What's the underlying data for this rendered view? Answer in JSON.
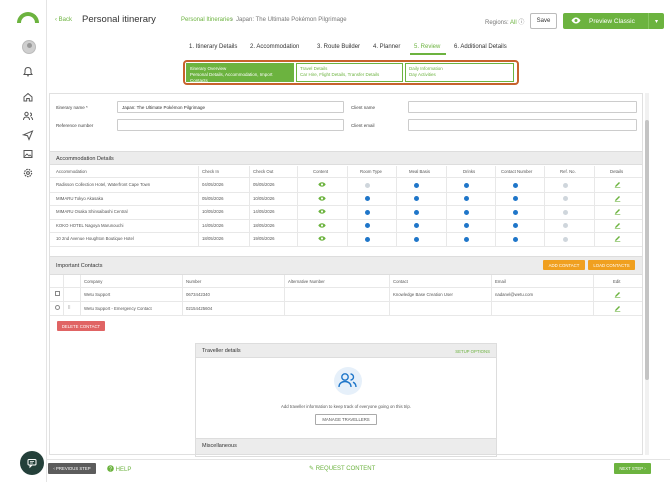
{
  "nav": {
    "icons": [
      "logo",
      "avatar",
      "bell-icon",
      "home-icon",
      "users-icon",
      "send-icon",
      "image-icon",
      "gear-icon"
    ]
  },
  "header": {
    "back": "Back",
    "title": "Personal itinerary",
    "crumb_parent": "Personal Itineraries",
    "crumb_sep": "›",
    "crumb_current": "Japan: The Ultimate Pokémon Pilgrimage",
    "regions_label": "Regions:",
    "regions_value": "All",
    "save": "Save",
    "preview": "Preview Classic",
    "preview_caret": "▾"
  },
  "steps": [
    "1. Itinerary Details",
    "2. Accommodation",
    "3. Route Builder",
    "4. Planner",
    "5. Review",
    "6. Additional Details"
  ],
  "active_step": "5. Review",
  "subtabs": [
    {
      "line1": "Itinerary Overview",
      "line2": "Personal Details, Accommodation, Import Contacts"
    },
    {
      "line1": "Travel Details",
      "line2": "Car Hire, Flight Details, Transfer Details"
    },
    {
      "line1": "Daily Information",
      "line2": "Day Activities"
    }
  ],
  "form": {
    "itinerary_name_label": "Itinerary name *",
    "itinerary_name_value": "Japan: The Ultimate Pokémon Pilgrimage",
    "reference_label": "Reference number",
    "client_name_label": "Client name",
    "client_email_label": "Client email"
  },
  "accommodation": {
    "title": "Accommodation Details",
    "columns": [
      "Accommodation",
      "Check In",
      "Check Out",
      "Content",
      "Room Type",
      "Meal Basis",
      "Drinks",
      "Contact Number",
      "Ref. No.",
      "Details"
    ],
    "rows": [
      {
        "name": "Radisson Collection Hotel, Waterfront Cape Town",
        "in": "04/05/2026",
        "out": "05/05/2026",
        "dots": [
          "grey",
          "blue",
          "blue",
          "blue",
          "grey"
        ]
      },
      {
        "name": "MIMARU Tokyo Akasaka",
        "in": "05/05/2026",
        "out": "10/05/2026",
        "dots": [
          "blue",
          "blue",
          "blue",
          "blue",
          "grey"
        ]
      },
      {
        "name": "MIMARU Osaka Shinsaibashi Central",
        "in": "10/05/2026",
        "out": "14/05/2026",
        "dots": [
          "blue",
          "blue",
          "blue",
          "blue",
          "grey"
        ]
      },
      {
        "name": "KOKO HOTEL Nagoya Marunouchi",
        "in": "14/05/2026",
        "out": "18/05/2026",
        "dots": [
          "blue",
          "blue",
          "blue",
          "blue",
          "grey"
        ]
      },
      {
        "name": "10 2nd Avenue Houghton Boutique Hotel",
        "in": "18/05/2026",
        "out": "19/05/2026",
        "dots": [
          "blue",
          "blue",
          "blue",
          "blue",
          "grey"
        ]
      }
    ]
  },
  "contacts": {
    "title": "Important Contacts",
    "add": "ADD CONTACT",
    "load": "LOAD CONTACTS",
    "columns": [
      "Company",
      "Number",
      "Alternative Number",
      "Contact",
      "Email",
      "Edit"
    ],
    "rows": [
      {
        "company": "Wetu Support",
        "number": "0673442340",
        "alt": "",
        "contact": "Knowledge Base Creation User",
        "email": "nadanel@wetu.com"
      },
      {
        "company": "Wetu Support - Emergency Contact",
        "number": "02154425604",
        "alt": "",
        "contact": "",
        "email": ""
      }
    ],
    "delete": "DELETE CONTACT"
  },
  "traveller": {
    "title": "Traveller details",
    "setup": "SETUP OPTIONS",
    "text": "Add traveller information to keep track of everyone going on this trip.",
    "manage": "MANAGE TRAVELLERS"
  },
  "misc": {
    "title": "Miscellaneous"
  },
  "footer": {
    "prev": "‹ PREVIOUS STEP",
    "help": "HELP",
    "request": "REQUEST CONTENT",
    "next": "NEXT STEP ›"
  },
  "colors": {
    "accent": "#6cb33f",
    "highlight": "#c7622c",
    "info": "#1f76c9",
    "warning": "#f0a020",
    "danger": "#e06464"
  }
}
